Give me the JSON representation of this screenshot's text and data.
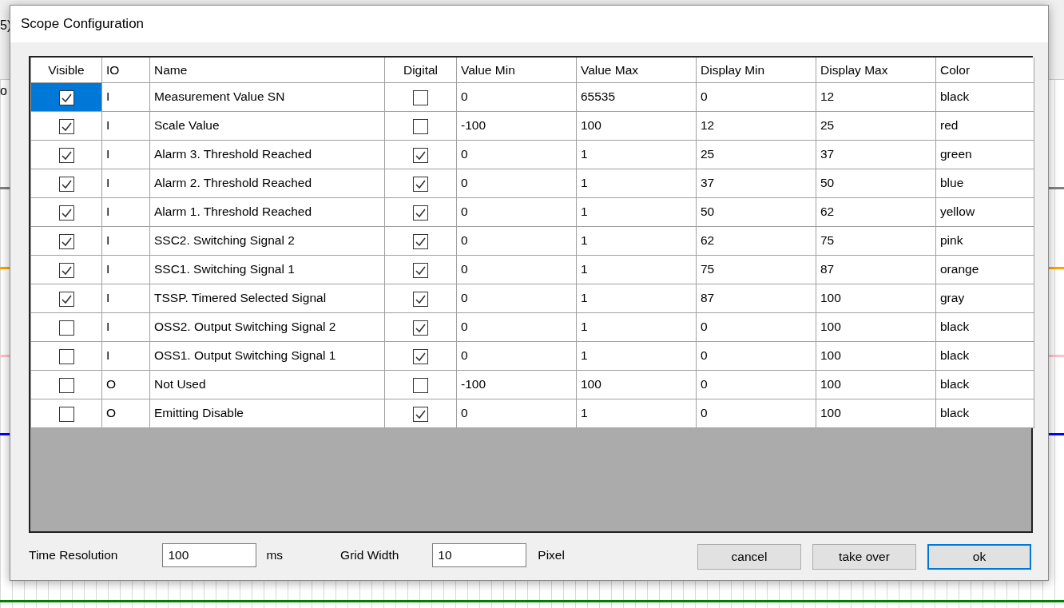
{
  "background": {
    "fragments": [
      "5)",
      "o"
    ],
    "traces": [
      {
        "color": "#808080"
      },
      {
        "color": "#ffa500"
      },
      {
        "color": "#ffc0cb"
      },
      {
        "color": "#0000ff"
      },
      {
        "color": "#008000"
      }
    ]
  },
  "window": {
    "title": "Scope Configuration"
  },
  "table": {
    "columns": [
      "Visible",
      "IO",
      "Name",
      "Digital",
      "Value Min",
      "Value Max",
      "Display Min",
      "Display Max",
      "Color"
    ],
    "rows": [
      {
        "selected": true,
        "visible": true,
        "io": "I",
        "name": "Measurement Value SN",
        "digital": false,
        "value_min": "0",
        "value_max": "65535",
        "display_min": "0",
        "display_max": "12",
        "color_name": "black"
      },
      {
        "selected": false,
        "visible": true,
        "io": "I",
        "name": "Scale Value",
        "digital": false,
        "value_min": "-100",
        "value_max": "100",
        "display_min": "12",
        "display_max": "25",
        "color_name": "red"
      },
      {
        "selected": false,
        "visible": true,
        "io": "I",
        "name": "Alarm 3. Threshold Reached",
        "digital": true,
        "value_min": "0",
        "value_max": "1",
        "display_min": "25",
        "display_max": "37",
        "color_name": "green"
      },
      {
        "selected": false,
        "visible": true,
        "io": "I",
        "name": "Alarm 2. Threshold Reached",
        "digital": true,
        "value_min": "0",
        "value_max": "1",
        "display_min": "37",
        "display_max": "50",
        "color_name": "blue"
      },
      {
        "selected": false,
        "visible": true,
        "io": "I",
        "name": "Alarm 1. Threshold Reached",
        "digital": true,
        "value_min": "0",
        "value_max": "1",
        "display_min": "50",
        "display_max": "62",
        "color_name": "yellow"
      },
      {
        "selected": false,
        "visible": true,
        "io": "I",
        "name": "SSC2. Switching Signal 2",
        "digital": true,
        "value_min": "0",
        "value_max": "1",
        "display_min": "62",
        "display_max": "75",
        "color_name": "pink"
      },
      {
        "selected": false,
        "visible": true,
        "io": "I",
        "name": "SSC1. Switching Signal 1",
        "digital": true,
        "value_min": "0",
        "value_max": "1",
        "display_min": "75",
        "display_max": "87",
        "color_name": "orange"
      },
      {
        "selected": false,
        "visible": true,
        "io": "I",
        "name": "TSSP. Timered Selected Signal",
        "digital": true,
        "value_min": "0",
        "value_max": "1",
        "display_min": "87",
        "display_max": "100",
        "color_name": "gray"
      },
      {
        "selected": false,
        "visible": false,
        "io": "I",
        "name": "OSS2. Output Switching Signal 2",
        "digital": true,
        "value_min": "0",
        "value_max": "1",
        "display_min": "0",
        "display_max": "100",
        "color_name": "black"
      },
      {
        "selected": false,
        "visible": false,
        "io": "I",
        "name": "OSS1. Output Switching Signal 1",
        "digital": true,
        "value_min": "0",
        "value_max": "1",
        "display_min": "0",
        "display_max": "100",
        "color_name": "black"
      },
      {
        "selected": false,
        "visible": false,
        "io": "O",
        "name": "Not Used",
        "digital": false,
        "value_min": "-100",
        "value_max": "100",
        "display_min": "0",
        "display_max": "100",
        "color_name": "black"
      },
      {
        "selected": false,
        "visible": false,
        "io": "O",
        "name": "Emitting Disable",
        "digital": true,
        "value_min": "0",
        "value_max": "1",
        "display_min": "0",
        "display_max": "100",
        "color_name": "black"
      }
    ]
  },
  "settings": [
    {
      "label": "Time Resolution",
      "value": "100",
      "unit": "ms"
    },
    {
      "label": "Grid Width",
      "value": "10",
      "unit": "Pixel"
    }
  ],
  "buttons": [
    {
      "label": "cancel",
      "default": false
    },
    {
      "label": "take over",
      "default": false
    },
    {
      "label": "ok",
      "default": true
    }
  ]
}
